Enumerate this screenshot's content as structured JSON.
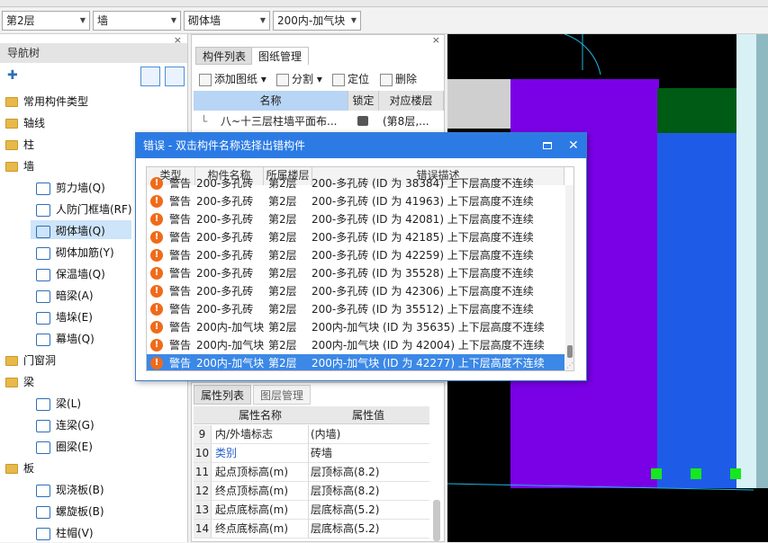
{
  "toolbar": {
    "floor": "第2层",
    "category": "墙",
    "type": "砌体墙",
    "component": "200内-加气块"
  },
  "nav": {
    "title": "导航树",
    "close": "×",
    "items": [
      {
        "label": "常用构件类型",
        "level": 0,
        "icon": "folder-icon"
      },
      {
        "label": "轴线",
        "level": 0,
        "icon": "folder-icon"
      },
      {
        "label": "柱",
        "level": 0,
        "icon": "folder-icon"
      },
      {
        "label": "墙",
        "level": 0,
        "icon": "folder-icon"
      },
      {
        "label": "剪力墙(Q)",
        "level": 1,
        "icon": "shear-wall-icon"
      },
      {
        "label": "人防门框墙(RF)",
        "level": 1,
        "icon": "door-frame-wall-icon"
      },
      {
        "label": "砌体墙(Q)",
        "level": 1,
        "icon": "masonry-wall-icon"
      },
      {
        "label": "砌体加筋(Y)",
        "level": 1,
        "icon": "masonry-rebar-icon"
      },
      {
        "label": "保温墙(Q)",
        "level": 1,
        "icon": "insulation-wall-icon"
      },
      {
        "label": "暗梁(A)",
        "level": 1,
        "icon": "hidden-beam-icon"
      },
      {
        "label": "墙垛(E)",
        "level": 1,
        "icon": "pilaster-icon"
      },
      {
        "label": "幕墙(Q)",
        "level": 1,
        "icon": "curtain-wall-icon"
      },
      {
        "label": "门窗洞",
        "level": 0,
        "icon": "folder-icon"
      },
      {
        "label": "梁",
        "level": 0,
        "icon": "folder-icon"
      },
      {
        "label": "梁(L)",
        "level": 1,
        "icon": "beam-icon"
      },
      {
        "label": "连梁(G)",
        "level": 1,
        "icon": "coupling-beam-icon"
      },
      {
        "label": "圈梁(E)",
        "level": 1,
        "icon": "ring-beam-icon"
      },
      {
        "label": "板",
        "level": 0,
        "icon": "folder-icon"
      },
      {
        "label": "现浇板(B)",
        "level": 1,
        "icon": "cast-slab-icon"
      },
      {
        "label": "螺旋板(B)",
        "level": 1,
        "icon": "spiral-slab-icon"
      },
      {
        "label": "柱帽(V)",
        "level": 1,
        "icon": "column-cap-icon"
      }
    ]
  },
  "components": {
    "tabs": [
      "构件列表",
      "图纸管理"
    ],
    "close": "×",
    "tools": [
      "添加图纸",
      "分割",
      "定位",
      "删除"
    ],
    "columns": [
      "名称",
      "锁定",
      "对应楼层"
    ],
    "row": {
      "name": "八~十三层柱墙平面布...",
      "floor": "(第8层,..."
    }
  },
  "dialog": {
    "title": "错误 - 双击构件名称选择出错构件",
    "columns": [
      "类型",
      "构件名称",
      "所属楼层",
      "错误描述"
    ],
    "rows": [
      {
        "type": "警告",
        "name": "200-多孔砖",
        "floor": "第2层",
        "desc": "200-多孔砖 (ID 为 38384) 上下层高度不连续"
      },
      {
        "type": "警告",
        "name": "200-多孔砖",
        "floor": "第2层",
        "desc": "200-多孔砖 (ID 为 41963) 上下层高度不连续"
      },
      {
        "type": "警告",
        "name": "200-多孔砖",
        "floor": "第2层",
        "desc": "200-多孔砖 (ID 为 42081) 上下层高度不连续"
      },
      {
        "type": "警告",
        "name": "200-多孔砖",
        "floor": "第2层",
        "desc": "200-多孔砖 (ID 为 42185) 上下层高度不连续"
      },
      {
        "type": "警告",
        "name": "200-多孔砖",
        "floor": "第2层",
        "desc": "200-多孔砖 (ID 为 42259) 上下层高度不连续"
      },
      {
        "type": "警告",
        "name": "200-多孔砖",
        "floor": "第2层",
        "desc": "200-多孔砖 (ID 为 35528) 上下层高度不连续"
      },
      {
        "type": "警告",
        "name": "200-多孔砖",
        "floor": "第2层",
        "desc": "200-多孔砖 (ID 为 42306) 上下层高度不连续"
      },
      {
        "type": "警告",
        "name": "200-多孔砖",
        "floor": "第2层",
        "desc": "200-多孔砖 (ID 为 35512) 上下层高度不连续"
      },
      {
        "type": "警告",
        "name": "200内-加气块",
        "floor": "第2层",
        "desc": "200内-加气块 (ID 为 35635) 上下层高度不连续"
      },
      {
        "type": "警告",
        "name": "200内-加气块",
        "floor": "第2层",
        "desc": "200内-加气块 (ID 为 42004) 上下层高度不连续"
      },
      {
        "type": "警告",
        "name": "200内-加气块",
        "floor": "第2层",
        "desc": "200内-加气块 (ID 为 42277) 上下层高度不连续"
      }
    ]
  },
  "props": {
    "tabs": [
      "属性列表",
      "图层管理"
    ],
    "columns": [
      "属性名称",
      "属性值"
    ],
    "rows": [
      {
        "n": "9",
        "k": "内/外墙标志",
        "v": "(内墙)"
      },
      {
        "n": "10",
        "k": "类别",
        "v": "砖墙"
      },
      {
        "n": "11",
        "k": "起点顶标高(m)",
        "v": "层顶标高(8.2)"
      },
      {
        "n": "12",
        "k": "终点顶标高(m)",
        "v": "层顶标高(8.2)"
      },
      {
        "n": "13",
        "k": "起点底标高(m)",
        "v": "层底标高(5.2)"
      },
      {
        "n": "14",
        "k": "终点底标高(m)",
        "v": "层底标高(5.2)"
      }
    ]
  },
  "colors": {
    "wall_purple": "#7a00e6",
    "wall_blue": "#1e5ce8",
    "wall_green": "#005c14",
    "grip": "#16e81e",
    "selection": "#3c88e6"
  }
}
